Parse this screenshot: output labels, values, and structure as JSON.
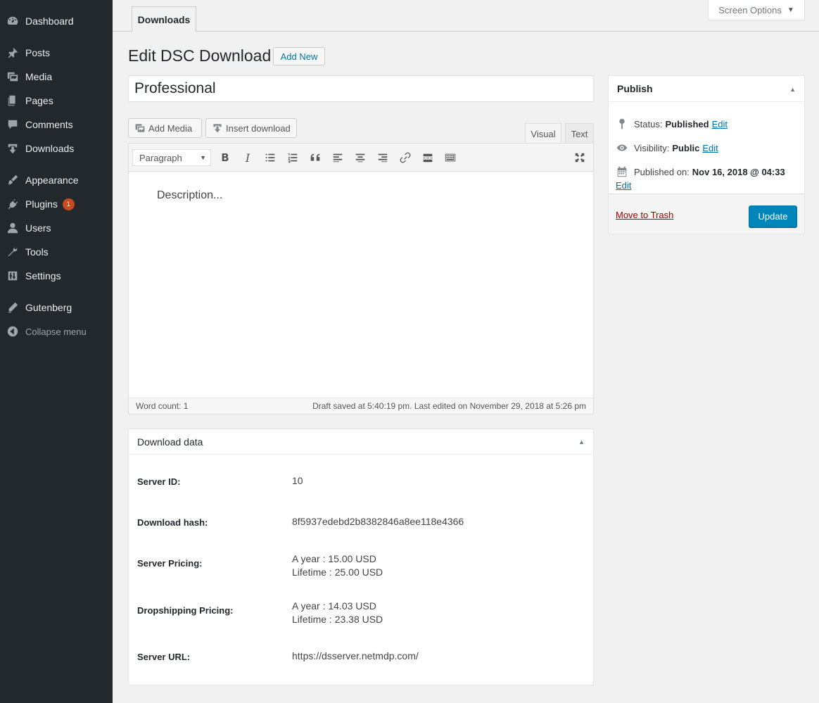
{
  "sidebar": {
    "items": [
      {
        "label": "Dashboard",
        "icon": "dashboard-icon"
      },
      {
        "label": "Posts",
        "icon": "pin-icon"
      },
      {
        "label": "Media",
        "icon": "media-icon"
      },
      {
        "label": "Pages",
        "icon": "pages-icon"
      },
      {
        "label": "Comments",
        "icon": "comment-icon"
      },
      {
        "label": "Downloads",
        "icon": "download-icon"
      },
      {
        "label": "Appearance",
        "icon": "brush-icon"
      },
      {
        "label": "Plugins",
        "icon": "plugin-icon",
        "badge": "1"
      },
      {
        "label": "Users",
        "icon": "user-icon"
      },
      {
        "label": "Tools",
        "icon": "wrench-icon"
      },
      {
        "label": "Settings",
        "icon": "settings-icon"
      },
      {
        "label": "Gutenberg",
        "icon": "pencil-icon"
      },
      {
        "label": "Collapse menu",
        "icon": "collapse-icon"
      }
    ]
  },
  "top": {
    "tab": "Downloads",
    "screen_options": "Screen Options"
  },
  "page": {
    "title": "Edit DSC Download",
    "add_new": "Add New",
    "post_title": "Professional"
  },
  "editor": {
    "add_media": "Add Media",
    "insert_download": "Insert download",
    "tab_visual": "Visual",
    "tab_text": "Text",
    "format": "Paragraph",
    "placeholder": "Description...",
    "word_count": "Word count: 1",
    "draft_status": "Draft saved at 5:40:19 pm. Last edited on November 29, 2018 at 5:26 pm"
  },
  "download_data": {
    "title": "Download data",
    "server_id_label": "Server ID:",
    "server_id": "10",
    "hash_label": "Download hash:",
    "hash": "8f5937edebd2b8382846a8ee118e4366",
    "server_pricing_label": "Server Pricing:",
    "server_pricing_year": "A year : 15.00 USD",
    "server_pricing_lifetime": "Lifetime : 25.00 USD",
    "drop_pricing_label": "Dropshipping Pricing:",
    "drop_pricing_year": "A year : 14.03 USD",
    "drop_pricing_lifetime": "Lifetime : 23.38 USD",
    "server_url_label": "Server URL:",
    "server_url": "https://dsserver.netmdp.com/"
  },
  "publish": {
    "title": "Publish",
    "status_label": "Status:",
    "status_value": "Published",
    "visibility_label": "Visibility:",
    "visibility_value": "Public",
    "published_label": "Published on:",
    "published_value": "Nov 16, 2018 @ 04:33",
    "edit": "Edit",
    "trash": "Move to Trash",
    "update": "Update"
  },
  "colors": {
    "sidebar_bg": "#23282d",
    "primary_button": "#0085ba",
    "link": "#0073aa",
    "trash": "#aa0000",
    "badge": "#ca4a1f"
  }
}
